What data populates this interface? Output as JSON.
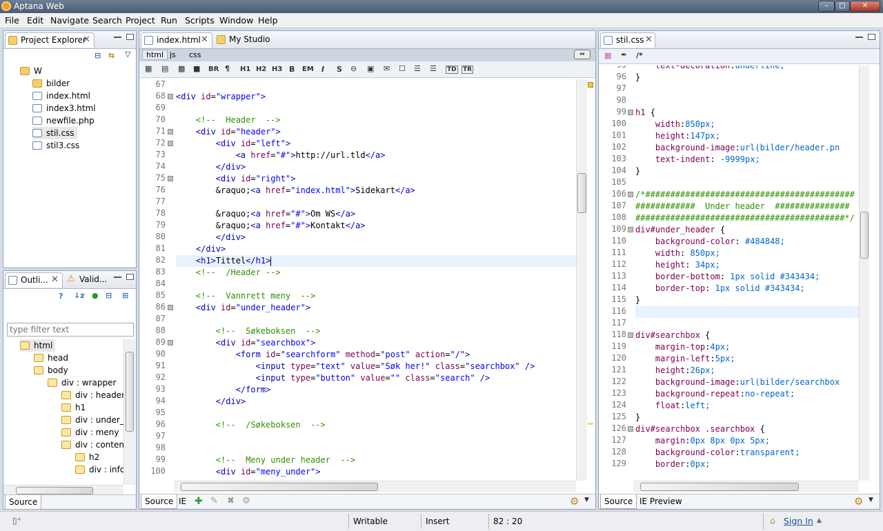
{
  "window": {
    "title": "Aptana Web"
  },
  "menu": [
    "File",
    "Edit",
    "Navigate",
    "Search",
    "Project",
    "Run",
    "Scripts",
    "Window",
    "Help"
  ],
  "project_explorer": {
    "tab_label": "Project Explorer",
    "root": "W",
    "items": [
      "bilder",
      "index.html",
      "index3.html",
      "newfile.php",
      "stil.css",
      "stil3.css"
    ],
    "selected": "stil.css"
  },
  "outline": {
    "tab_outline": "Outli...",
    "tab_valid": "Valid...",
    "filter_placeholder": "type filter text",
    "nodes": [
      "html",
      "head",
      "body",
      "div : wrapper",
      "div : header",
      "h1",
      "div : under_h",
      "div : meny",
      "div : content",
      "h2",
      "div : info"
    ],
    "bottom_tab": "Source"
  },
  "editor_left": {
    "tabs": [
      "index.html",
      "My Studio"
    ],
    "subtabs": [
      "html",
      "js",
      "css"
    ],
    "toolbar": [
      "BR",
      "¶",
      "H1",
      "H2",
      "H3",
      "B",
      "EM",
      "I",
      "S",
      "TD",
      "TR"
    ],
    "bottom_tabs": [
      "Source",
      "IE"
    ],
    "first_line": 67,
    "lines": [
      "",
      "<div id=\"wrapper\">",
      "",
      "    <!--  Header  -->",
      "    <div id=\"header\">",
      "        <div id=\"left\">",
      "            <a href=\"#\">http://url.tld</a>",
      "        </div>",
      "        <div id=\"right\">",
      "        &raquo;<a href=\"index.html\">Sidekart</a>",
      "",
      "        &raquo;<a href=\"#\">Om WS</a>",
      "        &raquo;<a href=\"#\">Kontakt</a>",
      "        </div>",
      "    </div>",
      "    <h1>Tittel</h1>",
      "    <!--  /Header -->",
      "",
      "    <!--  Vannrett meny  -->",
      "    <div id=\"under_header\">",
      "",
      "        <!--  Søkeboksen  -->",
      "        <div id=\"searchbox\">",
      "            <form id=\"searchform\" method=\"post\" action=\"/\">",
      "                <input type=\"text\" value=\"Søk her!\" class=\"searchbox\" />",
      "                <input type=\"button\" value=\"\" class=\"search\" />",
      "            </form>",
      "        </div>",
      "",
      "        <!--  /Søkeboksen  -->",
      "",
      "",
      "        <!--  Meny under header  -->",
      "        <div id=\"meny_under\">"
    ]
  },
  "editor_right": {
    "tab": "stil.css",
    "bottom_tabs": [
      "Source",
      "IE Preview"
    ],
    "first_line": 95,
    "lines": [
      "    text-decoration:underline;",
      "}",
      "",
      "",
      "h1 {",
      "    width:850px;",
      "    height:147px;",
      "    background-image:url(bilder/header.pn",
      "    text-indent: -9999px;",
      "}",
      "",
      "/*##########################################",
      "############  Under header  ###############",
      "##########################################*/",
      "div#under_header {",
      "    background-color: #484848;",
      "    width: 850px;",
      "    height: 34px;",
      "    border-bottom: 1px solid #343434;",
      "    border-top: 1px solid #343434;",
      "}",
      "",
      "",
      "div#searchbox {",
      "    margin-top:4px;",
      "    margin-left:5px;",
      "    height:26px;",
      "    background-image:url(bilder/searchbox",
      "    background-repeat:no-repeat;",
      "    float:left;",
      "}",
      "div#searchbox .searchbox {",
      "    margin:0px 8px 0px 5px;",
      "    background-color:transparent;",
      "    border:0px;"
    ]
  },
  "status": {
    "writable": "Writable",
    "insert": "Insert",
    "position": "82 : 20",
    "sign_in": "Sign In"
  }
}
